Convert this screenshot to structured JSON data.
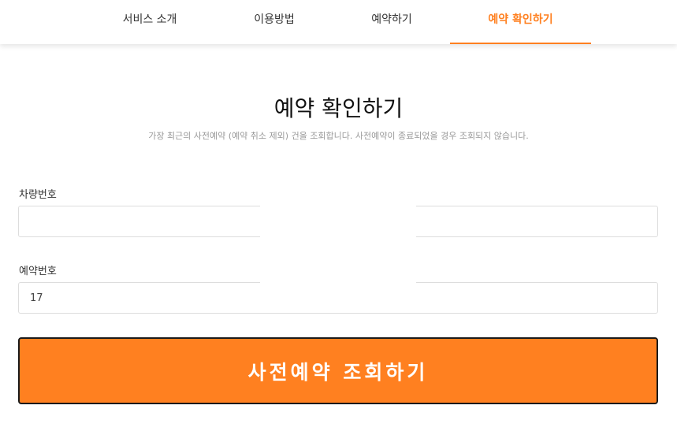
{
  "nav": {
    "tabs": [
      {
        "label": "서비스 소개"
      },
      {
        "label": "이용방법"
      },
      {
        "label": "예약하기"
      },
      {
        "label": "예약 확인하기"
      }
    ],
    "active_color": "#ff8020"
  },
  "page": {
    "title": "예약 확인하기",
    "subtitle": "가장 최근의 사전예약 (예약 취소 제외) 건을 조회합니다. 사전예약이 종료되었을 경우 조회되지 않습니다."
  },
  "form": {
    "vehicle_label": "차량번호",
    "vehicle_value": "",
    "reservation_label": "예약번호",
    "reservation_value": "17",
    "submit_label": "사전예약 조회하기"
  },
  "colors": {
    "accent": "#ff8020",
    "button_border": "#1a1a1a"
  }
}
